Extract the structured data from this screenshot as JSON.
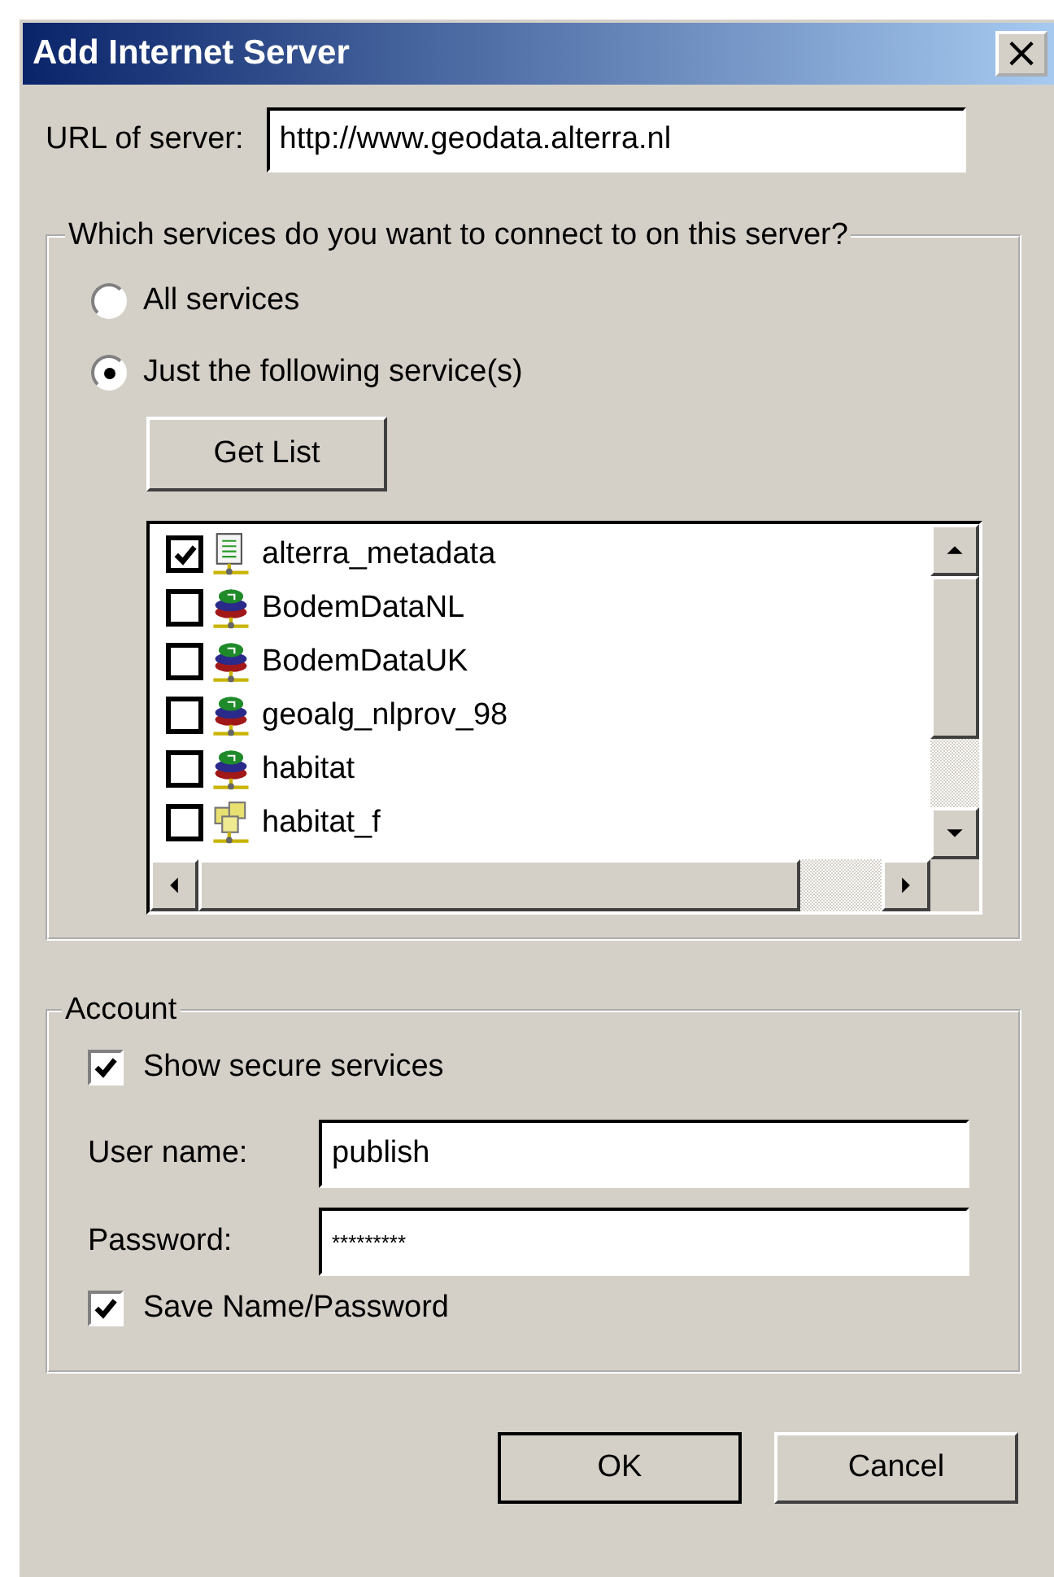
{
  "window": {
    "title": "Add Internet Server",
    "close": "×"
  },
  "url": {
    "label": "URL of  server:",
    "value": "http://www.geodata.alterra.nl"
  },
  "services": {
    "title": "Which services do you want to connect to on this server?",
    "options": [
      {
        "label": "All services",
        "selected": false
      },
      {
        "label": "Just the following service(s)",
        "selected": true
      }
    ],
    "get_list": "Get List",
    "items": [
      {
        "name": "alterra_metadata",
        "checked": true,
        "kind": "document"
      },
      {
        "name": "BodemDataNL",
        "checked": false,
        "kind": "layers"
      },
      {
        "name": "BodemDataUK",
        "checked": false,
        "kind": "layers"
      },
      {
        "name": "geoalg_nlprov_98",
        "checked": false,
        "kind": "layers"
      },
      {
        "name": "habitat",
        "checked": false,
        "kind": "layers"
      },
      {
        "name": "habitat_f",
        "checked": false,
        "kind": "folder"
      }
    ]
  },
  "account": {
    "title": "Account",
    "show_secure": {
      "label": "Show secure services",
      "checked": true
    },
    "user": {
      "label": "User name:",
      "value": "publish"
    },
    "password": {
      "label": "Password:",
      "value": "*********"
    },
    "save": {
      "label": "Save Name/Password",
      "checked": true
    }
  },
  "buttons": [
    {
      "label": "OK",
      "default": true
    },
    {
      "label": "Cancel",
      "default": false
    }
  ]
}
